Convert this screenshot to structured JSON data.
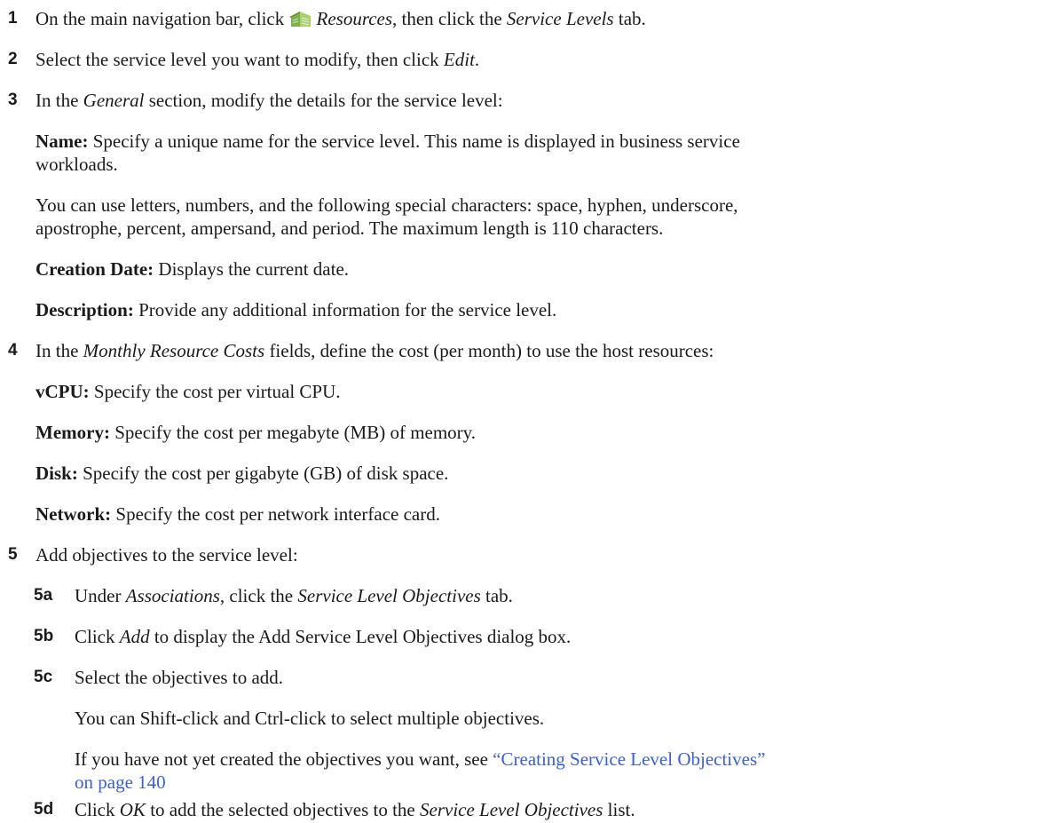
{
  "steps": [
    {
      "number": "1",
      "parts": {
        "a": "On the main navigation bar, click ",
        "b": "Resources",
        "c": ", then click the ",
        "d": "Service Levels",
        "e": " tab."
      },
      "icon": "resources-building-icon"
    },
    {
      "number": "2",
      "parts": {
        "a": "Select the service level you want to modify, then click ",
        "b": "Edit",
        "c": "."
      }
    },
    {
      "number": "3",
      "parts": {
        "a": "In the ",
        "b": "General",
        "c": " section, modify the details for the service level:"
      },
      "name_label": "Name:",
      "name_text_1": " Specify a unique name for the service level. This name is displayed in business service",
      "name_text_2": "workloads.",
      "chars_text_1": "You can use letters, numbers, and the following special characters: space, hyphen, underscore,",
      "chars_text_2": "apostrophe, percent, ampersand, and period. The maximum length is 110 characters.",
      "creation_label": "Creation Date:",
      "creation_text": " Displays the current date.",
      "description_label": "Description:",
      "description_text": " Provide any additional information for the service level."
    },
    {
      "number": "4",
      "parts": {
        "a": "In the ",
        "b": "Monthly Resource Costs",
        "c": " fields, define the cost (per month) to use the host resources:"
      },
      "vcpu_label": "vCPU:",
      "vcpu_text": " Specify the cost per virtual CPU.",
      "memory_label": "Memory:",
      "memory_text": " Specify the cost per megabyte (MB) of memory.",
      "disk_label": "Disk:",
      "disk_text": " Specify the cost per gigabyte (GB) of disk space.",
      "network_label": "Network:",
      "network_text": " Specify the cost per network interface card."
    },
    {
      "number": "5",
      "text": "Add objectives to the service level:",
      "substeps": [
        {
          "number": "5a",
          "parts": {
            "a": "Under ",
            "b": "Associations",
            "c": ", click the ",
            "d": "Service Level Objectives",
            "e": " tab."
          }
        },
        {
          "number": "5b",
          "parts": {
            "a": "Click ",
            "b": "Add",
            "c": " to display the Add Service Level Objectives dialog box."
          }
        },
        {
          "number": "5c",
          "text": "Select the objectives to add.",
          "note_1": "You can Shift-click and Ctrl-click to select multiple objectives.",
          "note_2": "If you have not yet created the objectives you want, see ",
          "link_1": "“Creating Service Level Objectives”",
          "link_2": "on page 140"
        },
        {
          "number": "5d",
          "parts": {
            "a": "Click ",
            "b": "OK",
            "c": " to add the selected objectives to the ",
            "d": "Service Level Objectives",
            "e": " list."
          }
        }
      ]
    }
  ],
  "colors": {
    "link": "#3a5fd9",
    "text": "#1a1a1a"
  }
}
